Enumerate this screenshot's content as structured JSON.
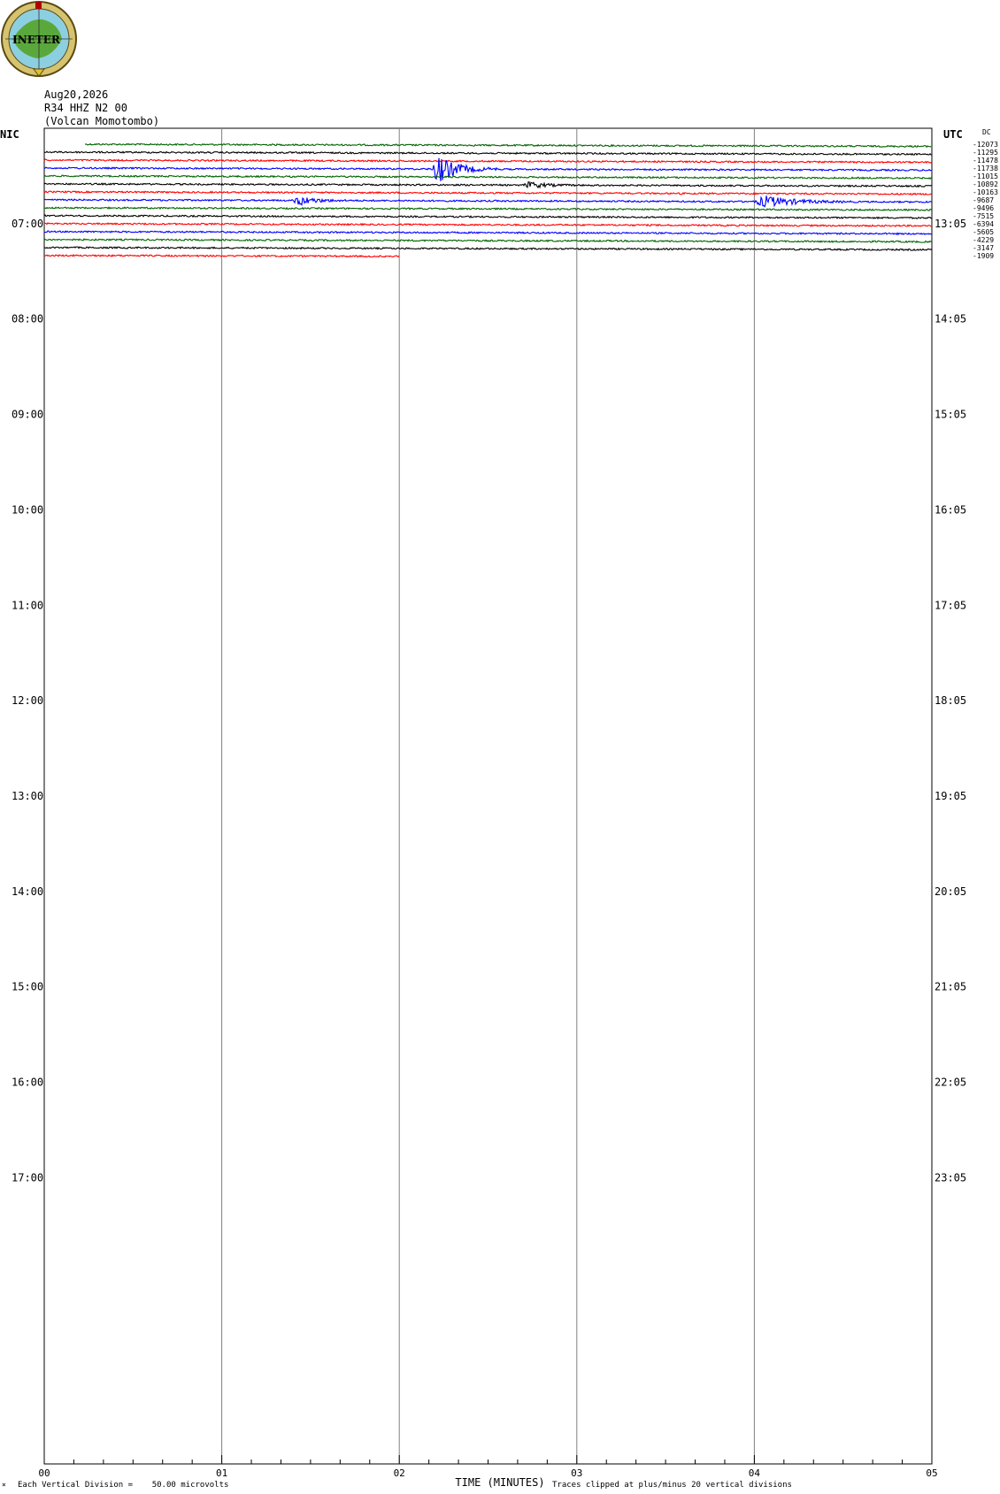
{
  "header": {
    "logo_text": "INETER",
    "date": "Aug20,2026",
    "station": "R34 HHZ N2 00",
    "location": "(Volcan Momotombo)"
  },
  "axes": {
    "left_label": "NIC",
    "right_label": "UTC",
    "dc_label": "DC",
    "x_label": "TIME (MINUTES)"
  },
  "footer": {
    "scale_mark": "×",
    "scale_text": "Each Vertical Division =    50.00 microvolts",
    "clip_text": "Traces clipped at plus/minus 20 vertical divisions"
  },
  "colors": {
    "trace_cycle": [
      "#006400",
      "#000000",
      "#ff0000",
      "#0000ff"
    ],
    "grid": "#808080"
  },
  "chart_data": {
    "type": "helicorder",
    "xlabel": "TIME (MINUTES)",
    "x_ticks": [
      "00",
      "01",
      "02",
      "03",
      "04",
      "05"
    ],
    "xlim": [
      0,
      5
    ],
    "left_hour_labels": [
      "07:00",
      "08:00",
      "09:00",
      "10:00",
      "11:00",
      "12:00",
      "13:00",
      "14:00",
      "15:00",
      "16:00",
      "17:00"
    ],
    "right_hour_labels": [
      "13:05",
      "14:05",
      "15:05",
      "16:05",
      "17:05",
      "18:05",
      "19:05",
      "20:05",
      "21:05",
      "22:05",
      "23:05"
    ],
    "rows_per_hour": 12,
    "total_rows": 168,
    "first_row_time": "06:00",
    "trace_count": 15,
    "trace_start_row": 1,
    "first_trace_start_minute": 0.23,
    "last_trace_end_minute": 2.0,
    "dc_offsets": [
      "-12073",
      "-11295",
      "-11478",
      "-11738",
      "-11015",
      "-10892",
      "-10163",
      "-9687",
      "-9496",
      "-7515",
      "-6394",
      "-5605",
      "-4229",
      "-3147",
      "-1909"
    ],
    "events": [
      {
        "trace": 3,
        "start_minute": 2.18,
        "end_minute": 2.55,
        "peak_divisions": 3.5
      },
      {
        "trace": 7,
        "start_minute": 1.4,
        "end_minute": 1.7,
        "peak_divisions": 1.2
      },
      {
        "trace": 7,
        "start_minute": 4.0,
        "end_minute": 4.55,
        "peak_divisions": 1.4
      },
      {
        "trace": 5,
        "start_minute": 2.7,
        "end_minute": 3.0,
        "peak_divisions": 0.8
      }
    ],
    "scale_microvolts_per_division": 50.0,
    "clip_divisions": 20
  }
}
